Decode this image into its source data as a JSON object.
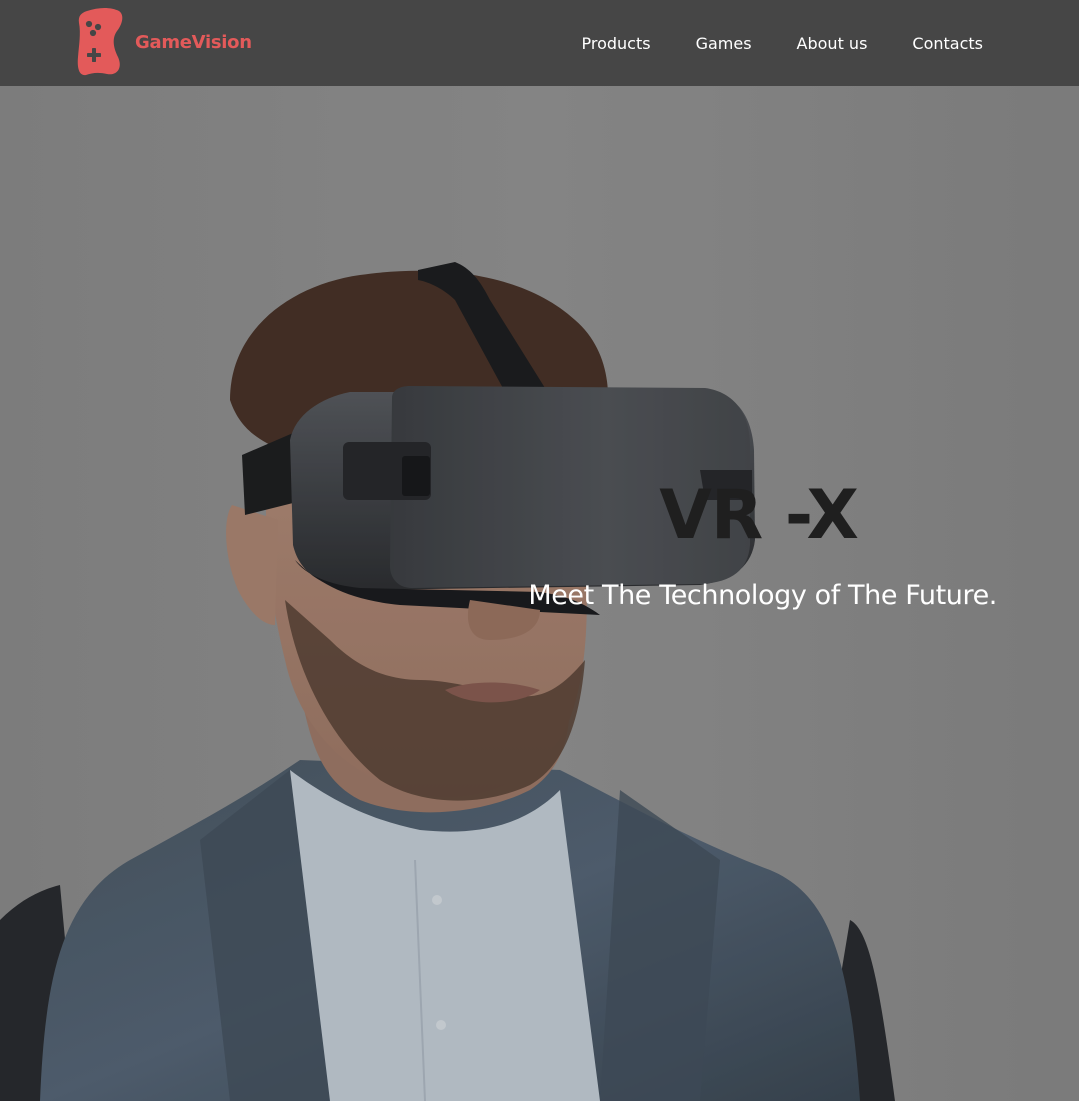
{
  "brand": {
    "name": "GameVision",
    "logo_icon": "gamepad-icon",
    "accent_color": "#e35a5a"
  },
  "nav": {
    "items": [
      {
        "label": "Products"
      },
      {
        "label": "Games"
      },
      {
        "label": "About us"
      },
      {
        "label": "Contacts"
      }
    ]
  },
  "hero": {
    "title": "VR -X",
    "subtitle": "Meet The Technology of The Future.",
    "image": "man-wearing-vr-headset-photo"
  },
  "colors": {
    "header_bg": "#464646",
    "title": "#1f1f1f",
    "subtitle": "#ffffff"
  }
}
